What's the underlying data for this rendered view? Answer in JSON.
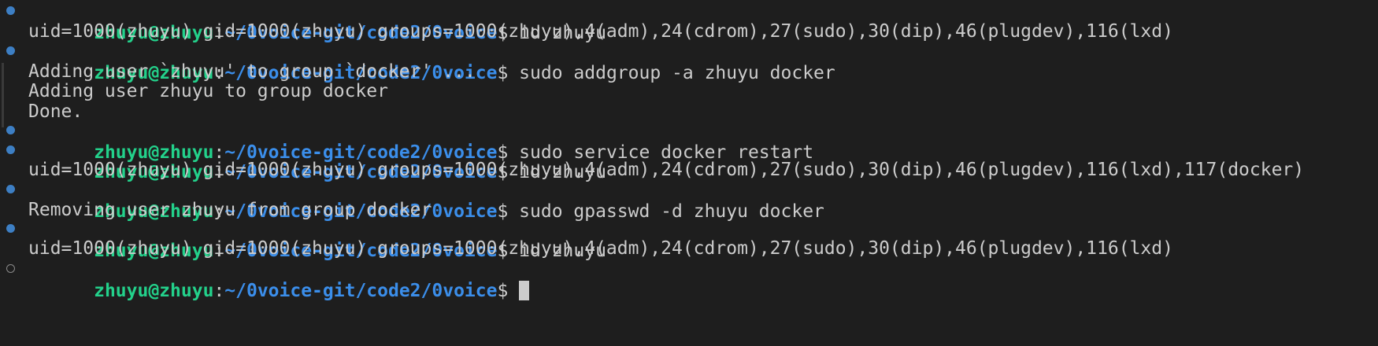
{
  "terminal": {
    "prompt": {
      "user_host": "zhuyu@zhuyu",
      "separator": ":",
      "path": "~/0voice-git/code2/0voice",
      "symbol": "$ "
    },
    "commands": [
      "id zhuyu",
      "sudo addgroup -a zhuyu docker",
      "sudo service docker restart",
      "id zhuyu",
      "sudo gpasswd -d zhuyu docker",
      "id zhuyu",
      ""
    ],
    "outputs": [
      "uid=1000(zhuyu) gid=1000(zhuyu) groups=1000(zhuyu),4(adm),24(cdrom),27(sudo),30(dip),46(plugdev),116(lxd)",
      "Adding user `zhuyu' to group `docker' ...",
      "Adding user zhuyu to group docker",
      "Done.",
      "uid=1000(zhuyu) gid=1000(zhuyu) groups=1000(zhuyu),4(adm),24(cdrom),27(sudo),30(dip),46(plugdev),116(lxd),117(docker)",
      "Removing user zhuyu from group docker",
      "uid=1000(zhuyu) gid=1000(zhuyu) groups=1000(zhuyu),4(adm),24(cdrom),27(sudo),30(dip),46(plugdev),116(lxd)"
    ],
    "decorations": {
      "success_icon": "filled-circle-icon",
      "pending_icon": "hollow-circle-icon"
    },
    "colors": {
      "background": "#1e1e1e",
      "user": "#23d18b",
      "path": "#3b8eea",
      "text": "#cccccc",
      "success_dot": "#3d7fc4",
      "pending_dot": "#8a8a8a"
    }
  }
}
